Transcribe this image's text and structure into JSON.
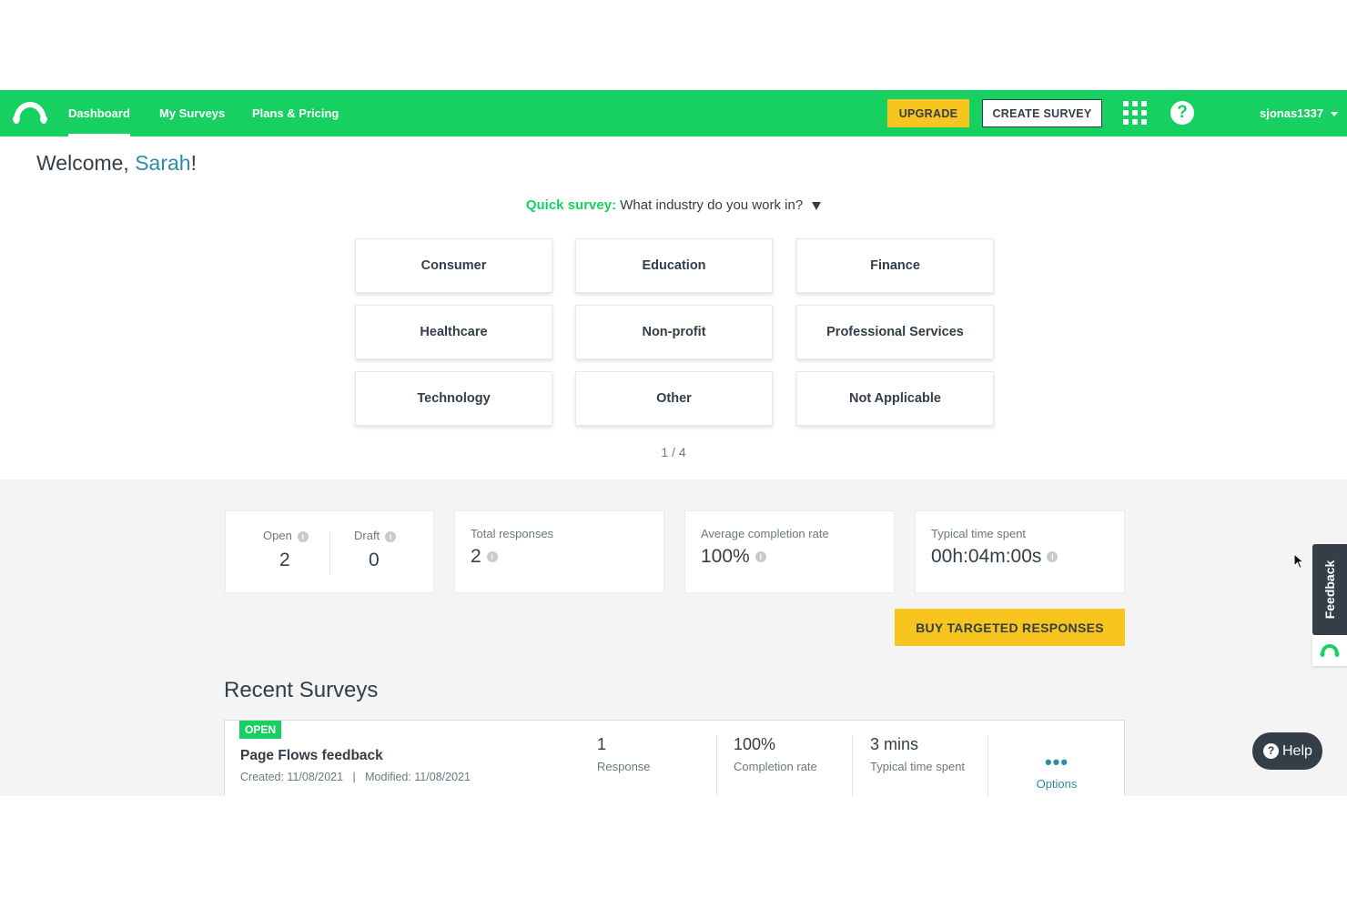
{
  "nav": {
    "items": [
      {
        "label": "Dashboard"
      },
      {
        "label": "My Surveys"
      },
      {
        "label": "Plans & Pricing"
      }
    ],
    "upgrade_label": "UPGRADE",
    "create_label": "CREATE SURVEY",
    "help_glyph": "?",
    "username": "sjonas1337"
  },
  "welcome": {
    "prefix": "Welcome, ",
    "name": "Sarah",
    "suffix": "!"
  },
  "quick_survey": {
    "label": "Quick survey:",
    "question": " What industry do you work in?",
    "options": [
      "Consumer",
      "Education",
      "Finance",
      "Healthcare",
      "Non-profit",
      "Professional Services",
      "Technology",
      "Other",
      "Not Applicable"
    ],
    "pager": "1 / 4"
  },
  "stats": {
    "open_label": "Open",
    "open_value": "2",
    "draft_label": "Draft",
    "draft_value": "0",
    "total_label": "Total responses",
    "total_value": "2",
    "completion_label": "Average completion rate",
    "completion_value": "100%",
    "time_label": "Typical time spent",
    "time_value": "00h:04m:00s",
    "info_glyph": "i"
  },
  "buy_label": "BUY TARGETED RESPONSES",
  "recent": {
    "title": "Recent Surveys",
    "survey": {
      "status": "OPEN",
      "name": "Page Flows feedback",
      "meta": "Created: 11/08/2021   |   Modified: 11/08/2021",
      "responses_value": "1",
      "responses_label": "Response",
      "completion_value": "100%",
      "completion_label": "Completion rate",
      "time_value": "3 mins",
      "time_label": "Typical time spent",
      "options_label": "Options"
    }
  },
  "feedback_label": "Feedback",
  "help_label": "Help",
  "colors": {
    "brand": "#16d162",
    "accent_yellow": "#f7c51d",
    "dark": "#333e48",
    "link": "#2c8ca8"
  },
  "icons": [
    "monkey-logo-icon",
    "apps-grid-icon",
    "help-circle-icon",
    "chevron-down-icon",
    "info-icon",
    "more-dots-icon",
    "cursor-icon"
  ]
}
